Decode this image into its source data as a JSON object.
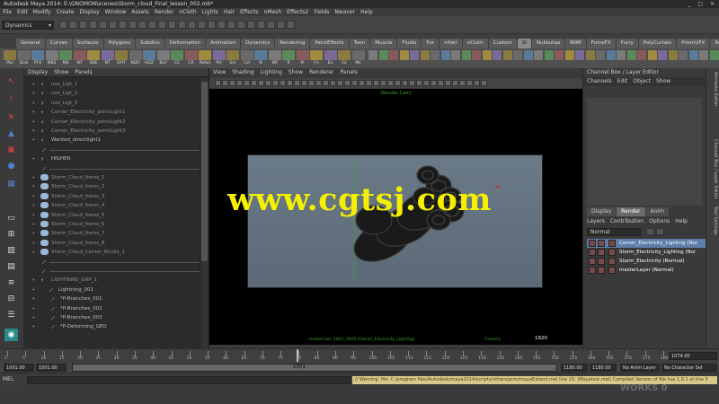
{
  "title": "Autodesk Maya 2014: E:\\GNOMON\\scenes\\Storm_cloud_Final_lesson_002.mb*",
  "window_buttons": "_ □ ✕",
  "menus": [
    "File",
    "Edit",
    "Modify",
    "Create",
    "Display",
    "Window",
    "Assets",
    "Render",
    "nCloth",
    "Lights",
    "Hair",
    "Effects",
    "nMesh",
    "Effects2",
    "Fields",
    "Nwaver",
    "Help"
  ],
  "status": {
    "mode": "Dynamics"
  },
  "shelf_tabs": [
    "General",
    "Curves",
    "Surfaces",
    "Polygons",
    "Subdivs",
    "Deformation",
    "Animation",
    "Dynamics",
    "Rendering",
    "PaintEffects",
    "Toon",
    "Muscle",
    "Fluids",
    "Fur",
    "nHair",
    "nCloth",
    "Custom",
    "SI",
    "Nukkutaa",
    "BNM",
    "FumeFX",
    "Furry",
    "PolyCurtain",
    "PrismUFX",
    "RealFlow"
  ],
  "shelf_active": "SI",
  "shelf_icon_labels": [
    "P&I",
    "Disk",
    "PFX",
    "MBS",
    "MB",
    "NT",
    "SNE",
    "NT",
    "EMT",
    "NDO",
    "HDZ",
    "BLP",
    "CE",
    "CR",
    "Nebd",
    "Prt",
    "Sm",
    "Cst",
    "N",
    "Wf",
    "Tr",
    "Pl",
    "Fn",
    "Ex",
    "Gr",
    "Ms"
  ],
  "outliner": {
    "menu": [
      "Display",
      "Show",
      "Panels"
    ],
    "rows": [
      {
        "label": "use_Ligt_1",
        "style": "dim"
      },
      {
        "label": "use_Ligt_2",
        "style": "dim"
      },
      {
        "label": "use_Ligt_3",
        "style": "dim"
      },
      {
        "label": "Corner_Electricity_pointLight1",
        "style": "dim"
      },
      {
        "label": "Corner_Electricity_pointLight2",
        "style": "dim"
      },
      {
        "label": "Corner_Electricity_pointLight3",
        "style": "dim"
      },
      {
        "label": "Wanted_directlight1",
        "style": "norm"
      },
      {
        "label": "",
        "style": "node"
      },
      {
        "label": "HIGHER",
        "style": "norm"
      },
      {
        "label": "",
        "style": "node"
      },
      {
        "label": "Storm_Cloud_Items_1",
        "style": "dim"
      },
      {
        "label": "Storm_Cloud_Items_2",
        "style": "dim"
      },
      {
        "label": "Storm_Cloud_Items_3",
        "style": "dim"
      },
      {
        "label": "Storm_Cloud_Items_4",
        "style": "dim"
      },
      {
        "label": "Storm_Cloud_Items_5",
        "style": "dim"
      },
      {
        "label": "Storm_Cloud_Items_6",
        "style": "dim"
      },
      {
        "label": "Storm_Cloud_Items_7",
        "style": "dim"
      },
      {
        "label": "Storm_Cloud_Items_8",
        "style": "dim"
      },
      {
        "label": "Storm_Cloud_Center_Bricks_1",
        "style": "dim"
      },
      {
        "label": "",
        "style": "node"
      },
      {
        "label": "",
        "style": "node"
      },
      {
        "label": "LIGHTNING_GRP_1",
        "style": "dim"
      },
      {
        "label": "Lightning_001",
        "style": "norm"
      },
      {
        "label": "*P-Branches_001",
        "style": "norm"
      },
      {
        "label": "*P-Branches_002",
        "style": "norm"
      },
      {
        "label": "*P-Branches_003",
        "style": "norm"
      },
      {
        "label": "*P-Deforming_GEO",
        "style": "norm"
      }
    ]
  },
  "viewport": {
    "menu": [
      "View",
      "Shading",
      "Lighting",
      "Show",
      "Renderer",
      "Panels"
    ],
    "cam_top": "(Render Cam)",
    "cam_bottom": "renderCam: 1851_1920 (Corner_Electricity_Lighting)",
    "resolution": "1920",
    "camera_label": "Camera"
  },
  "channel_box": {
    "header": "Channel Box / Layer Editor",
    "menu": [
      "Channels",
      "Edit",
      "Object",
      "Show"
    ],
    "layer_tabs": [
      "Display",
      "Render",
      "Anim"
    ],
    "active_tab": "Render",
    "layer_menu": [
      "Layers",
      "Contribution",
      "Options",
      "Help"
    ],
    "layer_mode": "Normal",
    "layers": [
      {
        "name": "Corner_Electricity_Lighting (Nor",
        "selected": true
      },
      {
        "name": "Storm_Electricity_Lighting (Nor",
        "selected": false
      },
      {
        "name": "Storm_Electricity (Normal)",
        "selected": false
      },
      {
        "name": "masterLayer (Normal)",
        "selected": false
      }
    ]
  },
  "right_strip": [
    "Attribute Editor",
    "Channel Box / Layer Editor",
    "Tool Settings"
  ],
  "timeline": {
    "ticks": [
      "2",
      "5",
      "10",
      "15",
      "20",
      "25",
      "30",
      "35",
      "40",
      "45",
      "50",
      "55",
      "60",
      "65",
      "70",
      "75",
      "80",
      "85",
      "90",
      "95",
      "100",
      "105",
      "110",
      "115",
      "120",
      "125",
      "130",
      "135",
      "140",
      "145",
      "150",
      "155",
      "160",
      "165",
      "170",
      "175",
      "180"
    ],
    "current_frame": "1074.00",
    "start": "1001.00",
    "start2": "1001.00",
    "end": "1180.00",
    "end2": "1180.00",
    "range_label": "1001",
    "anim_layer": "No Anim Layer",
    "char_set": "No Character Set"
  },
  "command": {
    "tag": "MEL",
    "warning": "// Warning: file: C:/program files/Autodesk/maya2014/scripts/others/pcm/mayaExtend.mel line 15: (Mayatest.mel) Compiled Version of file has 1.0.1 at line 3",
    "help": ""
  },
  "watermark": "www.cgtsj.com",
  "watermark2": "WORKS 0",
  "colors": {
    "accent": "#5d7eaa",
    "watermark": "#f4f000",
    "warning_bg": "#d8c98a"
  }
}
